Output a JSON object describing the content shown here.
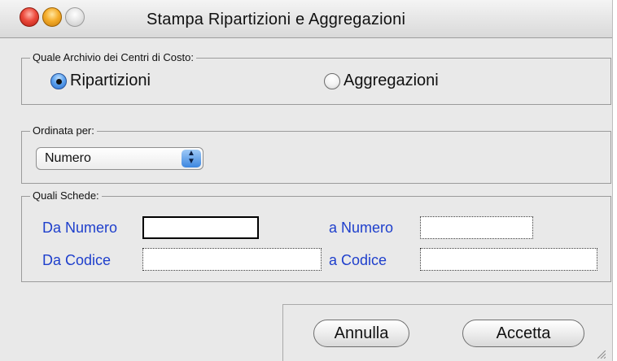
{
  "window": {
    "title": "Stampa Ripartizioni e Aggregazioni"
  },
  "archivio": {
    "legend": "Quale Archivio dei Centri di Costo:",
    "options": [
      {
        "label": "Ripartizioni",
        "selected": true
      },
      {
        "label": "Aggregazioni",
        "selected": false
      }
    ]
  },
  "ordinata": {
    "legend": "Ordinata per:",
    "selected": "Numero"
  },
  "schede": {
    "legend": "Quali Schede:",
    "da_numero_label": "Da Numero",
    "a_numero_label": "a Numero",
    "da_codice_label": "Da Codice",
    "a_codice_label": "a Codice",
    "da_numero_value": "",
    "a_numero_value": "",
    "da_codice_value": "",
    "a_codice_value": ""
  },
  "buttons": {
    "annulla": "Annulla",
    "accetta": "Accetta"
  },
  "colors": {
    "field_label": "#1e3fcc",
    "accent": "#3d86df"
  }
}
